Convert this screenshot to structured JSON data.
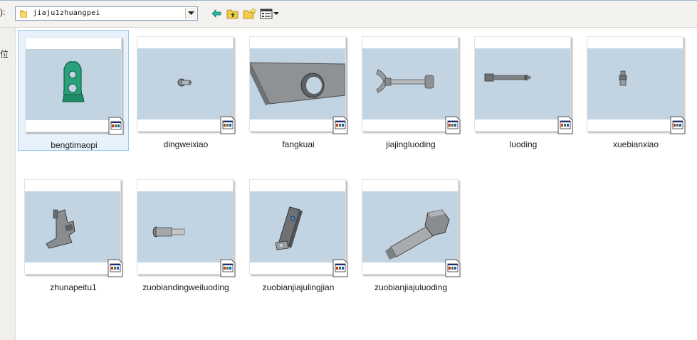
{
  "toolbar": {
    "look_in_label": "):",
    "path": "jiaju1zhuangpei"
  },
  "left_strip": {
    "char": "位"
  },
  "colors": {
    "viewport": "#c2d3e2",
    "selection_bg": "#e8f2fc",
    "selection_border": "#99c9ef",
    "model_green": "#2aa17a",
    "model_gray": "#8a8d90"
  },
  "files": [
    {
      "name": "bengtimaopi",
      "icon": "green-part-icon",
      "selected": true
    },
    {
      "name": "dingweixiao",
      "icon": "small-pin-icon",
      "selected": false
    },
    {
      "name": "fangkuai",
      "icon": "block-with-hole-icon",
      "selected": false
    },
    {
      "name": "jiajingluoding",
      "icon": "wing-screw-icon",
      "selected": false
    },
    {
      "name": "luoding",
      "icon": "bolt-icon",
      "selected": false
    },
    {
      "name": "xuebianxiao",
      "icon": "small-stud-icon",
      "selected": false
    },
    {
      "name": "zhunapeitu1",
      "icon": "assembly-icon",
      "selected": false
    },
    {
      "name": "zuobiandingweiluoding",
      "icon": "pin-icon",
      "selected": false
    },
    {
      "name": "zuobianjiajulingjian",
      "icon": "plate-icon",
      "selected": false
    },
    {
      "name": "zuobianjiajuluoding",
      "icon": "hex-bolt-icon",
      "selected": false
    }
  ]
}
